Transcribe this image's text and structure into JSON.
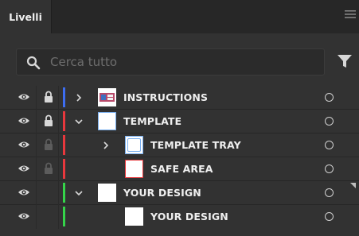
{
  "panel": {
    "tab_label": "Livelli",
    "menu_icon": "hamburger-menu-icon"
  },
  "search": {
    "placeholder": "Cerca tutto",
    "value": "",
    "icon": "search-icon",
    "filter_icon": "filter-icon"
  },
  "colors": {
    "blue": "#3d6df0",
    "red": "#e8383d",
    "green": "#35d44a",
    "thumb_border": "#7ab0f0"
  },
  "layers": [
    {
      "name": "INSTRUCTIONS",
      "visible": true,
      "locked": true,
      "color": "blue",
      "expanded": false,
      "level": 0
    },
    {
      "name": "TEMPLATE",
      "visible": true,
      "locked": true,
      "color": "red",
      "expanded": true,
      "level": 0
    },
    {
      "name": "TEMPLATE TRAY",
      "visible": true,
      "locked": "inherited",
      "color": "red",
      "expanded": false,
      "level": 1
    },
    {
      "name": "SAFE AREA",
      "visible": true,
      "locked": "inherited",
      "color": "red",
      "expanded": null,
      "level": 1
    },
    {
      "name": "YOUR DESIGN",
      "visible": true,
      "locked": false,
      "color": "green",
      "expanded": true,
      "level": 0
    },
    {
      "name": "YOUR DESIGN",
      "visible": true,
      "locked": false,
      "color": "green",
      "expanded": null,
      "level": 1
    }
  ]
}
